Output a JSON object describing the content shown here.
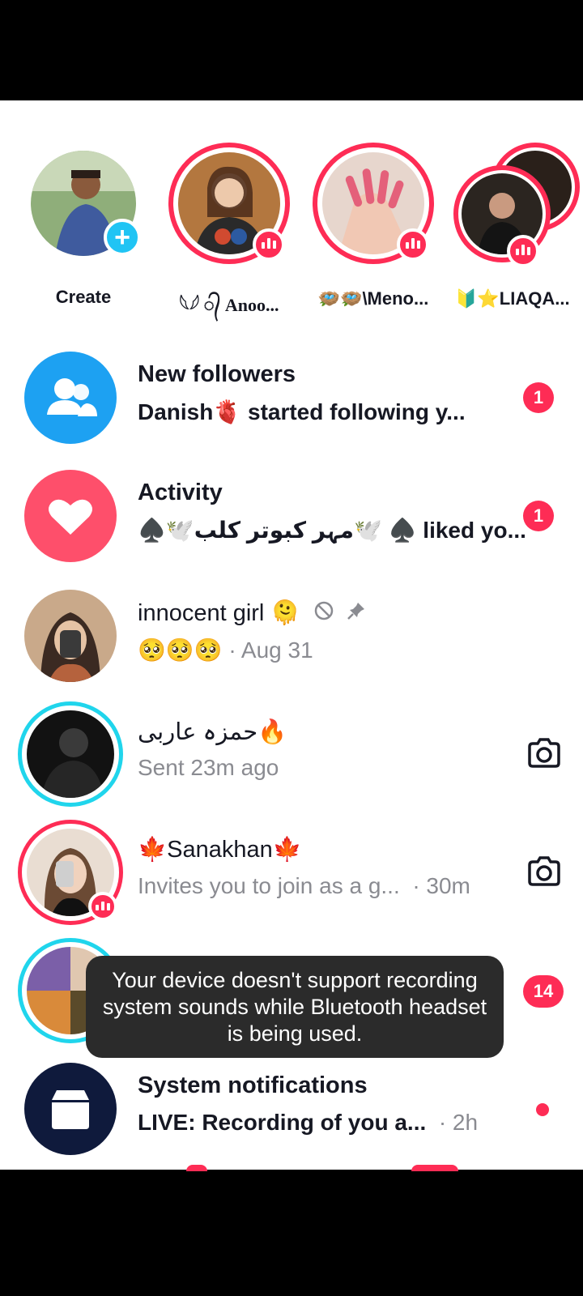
{
  "stories": [
    {
      "name": "Create",
      "badge": "plus-icon"
    },
    {
      "name": "𓆩𓆪 ᭄ Anoo...",
      "badge": "live-icon"
    },
    {
      "name": "🪺🪺\\Meno...",
      "badge": "live-icon"
    },
    {
      "name": "🔰⭐LIAQA...",
      "badge": "live-icon"
    }
  ],
  "rows": [
    {
      "title": "New followers",
      "subtitle": "Danish🫀  started following y...",
      "count": "1",
      "icon": "people-icon"
    },
    {
      "title": "Activity",
      "subtitle": "♠️🕊️مہر کبوتر کلب🕊️ ♠️ liked yo...",
      "count": "1",
      "icon": "heart-icon"
    },
    {
      "title": "innocent girl 🫠",
      "subtitle_emoji": "🥺🥺🥺",
      "time": "· Aug 31",
      "muted_icon": "mute-icon",
      "pinned_icon": "pin-icon"
    },
    {
      "title": "حمزہ عاربی🔥",
      "subtitle": "Sent 23m ago",
      "action": "camera-icon"
    },
    {
      "title": "🍁Sanakhan🍁",
      "subtitle": "Invites you to join as a g...",
      "time": "· 30m",
      "action": "camera-icon"
    },
    {
      "count": "14"
    },
    {
      "title": "System notifications",
      "subtitle": "LIVE: Recording of you a...",
      "time": "· 2h",
      "icon": "inbox-icon"
    }
  ],
  "toast": {
    "text": "Your device doesn't support recording system sounds while Bluetooth headset is being used."
  },
  "colors": {
    "accent": "#fe2c55",
    "followers_bg": "#1da1f2",
    "activity_bg": "#fe4f6b",
    "system_bg": "#0f1a3c",
    "ring_cyan": "#20d5ec"
  }
}
